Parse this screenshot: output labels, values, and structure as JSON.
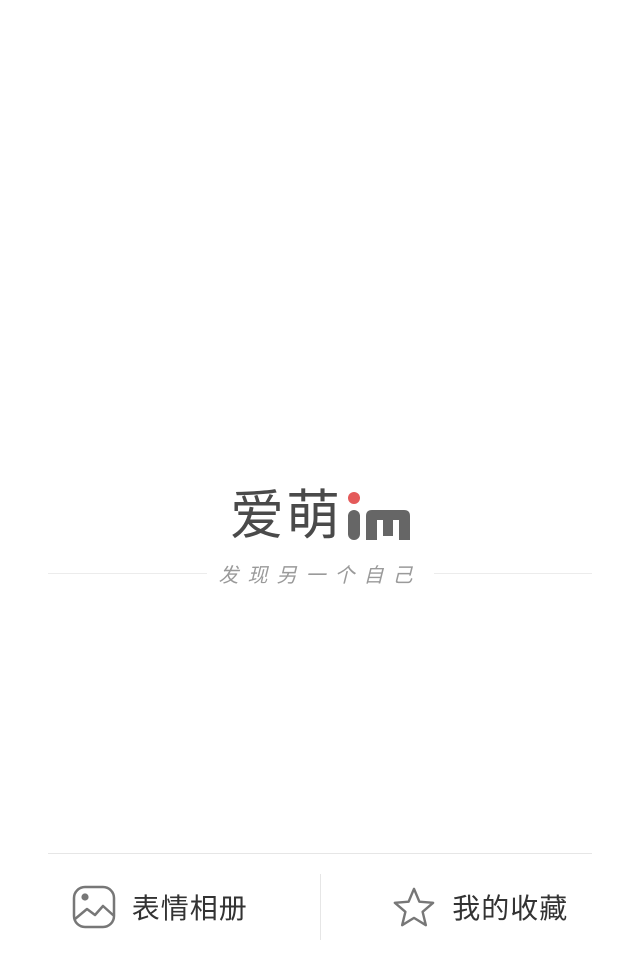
{
  "splash": {
    "logo_text": "爱萌",
    "logo_suffix": "iM",
    "tagline": "发现另一个自己"
  },
  "bottom_bar": {
    "album": {
      "label": "表情相册",
      "icon": "image-icon"
    },
    "favorites": {
      "label": "我的收藏",
      "icon": "star-icon"
    }
  },
  "colors": {
    "logo_text": "#4a4a4a",
    "logo_dot": "#e45a5a",
    "tagline": "#9a9a9a",
    "icon": "#777777",
    "label": "#333333",
    "divider": "#e6e6e6"
  }
}
